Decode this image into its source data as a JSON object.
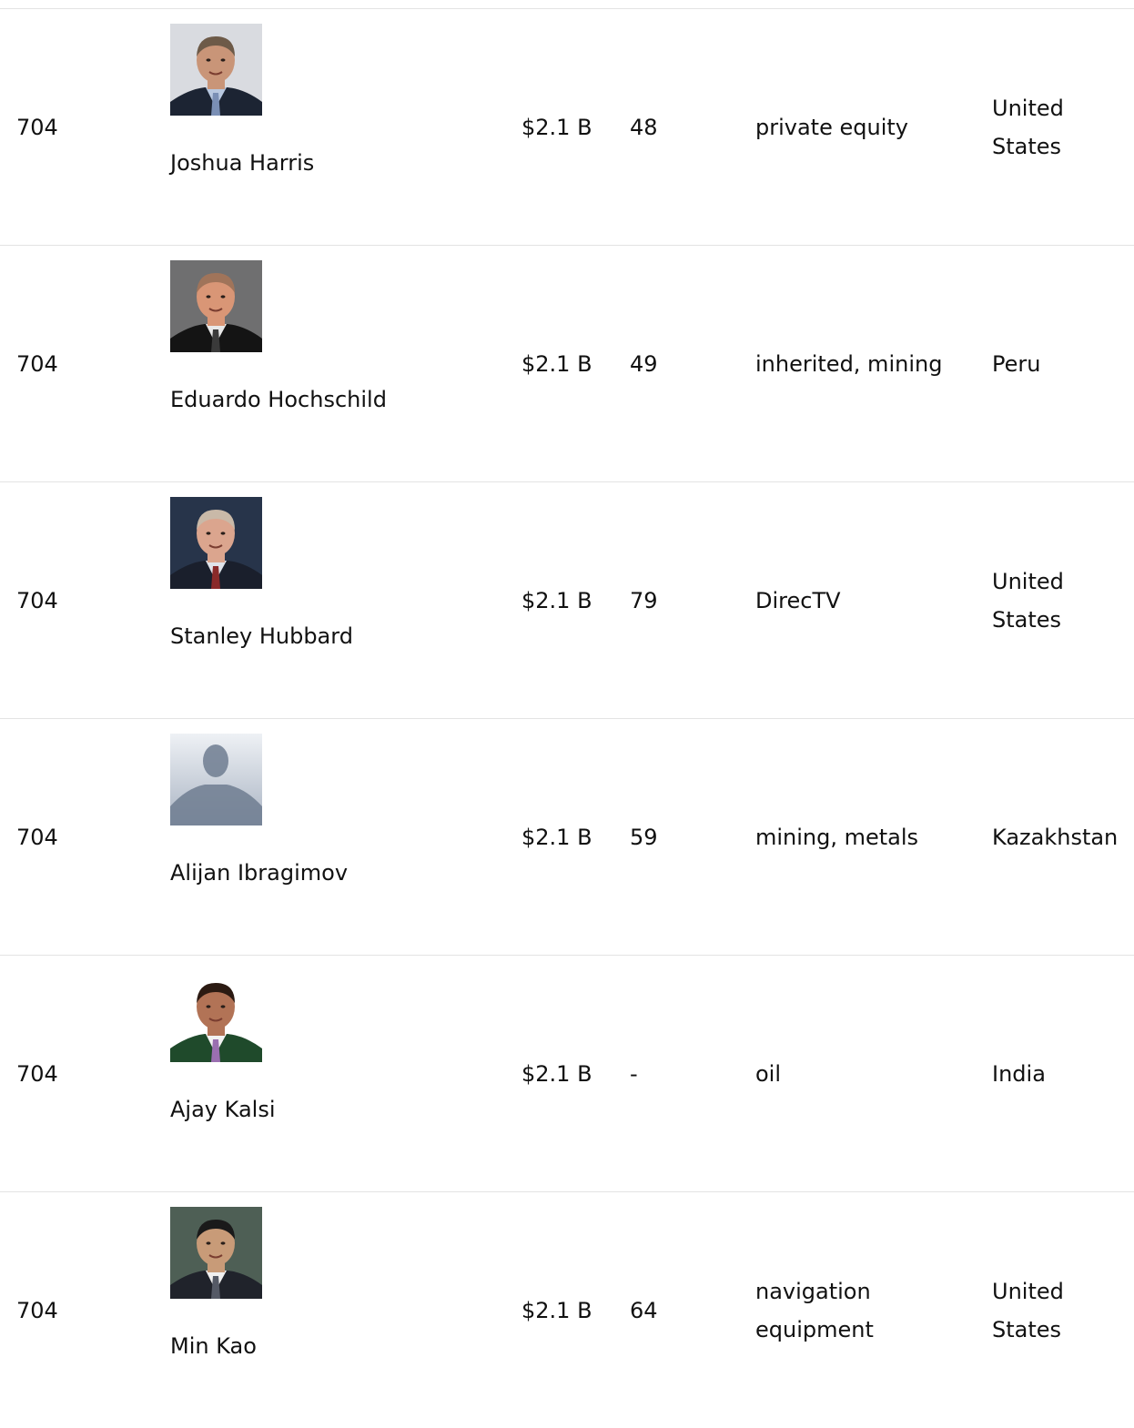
{
  "rows": [
    {
      "rank": "704",
      "name": "Joshua Harris",
      "net_worth": "$2.1 B",
      "age": "48",
      "source": "private equity",
      "country": "United States",
      "photo_icon": "person-photo-icon",
      "photo_colors": {
        "bg": "#d9dbe0",
        "skin": "#c99578",
        "hair": "#6d5a48",
        "suit": "#1c2433",
        "shirt": "#b8c8e0",
        "tie": "#7a8fb5"
      }
    },
    {
      "rank": "704",
      "name": "Eduardo Hochschild",
      "net_worth": "$2.1 B",
      "age": "49",
      "source": "inherited, mining",
      "country": "Peru",
      "photo_icon": "person-photo-icon",
      "photo_colors": {
        "bg": "#6f6f70",
        "skin": "#d99676",
        "hair": "#a0745a",
        "suit": "#141414",
        "shirt": "#e8e8e8",
        "tie": "#3a3a3a"
      }
    },
    {
      "rank": "704",
      "name": "Stanley Hubbard",
      "net_worth": "$2.1 B",
      "age": "79",
      "source": "DirecTV",
      "country": "United States",
      "photo_icon": "person-photo-icon",
      "photo_colors": {
        "bg": "#27344a",
        "skin": "#dba58e",
        "hair": "#c9b9a8",
        "suit": "#1a1f2c",
        "shirt": "#dfe3ea",
        "tie": "#8a2a2a"
      }
    },
    {
      "rank": "704",
      "name": "Alijan Ibragimov",
      "net_worth": "$2.1 B",
      "age": "59",
      "source": "mining, metals",
      "country": "Kazakhstan",
      "photo_icon": "silhouette-placeholder-icon",
      "photo_colors": {
        "bg_top": "#eef1f5",
        "bg_bottom": "#aab4c3",
        "figure": "#6f7c90"
      }
    },
    {
      "rank": "704",
      "name": "Ajay Kalsi",
      "net_worth": "$2.1 B",
      "age": "-",
      "source": "oil",
      "country": "India",
      "photo_icon": "person-photo-icon",
      "photo_colors": {
        "bg": "#ffffff",
        "skin": "#b27356",
        "hair": "#2b1a12",
        "suit": "#1f4a2b",
        "shirt": "#f2f2f2",
        "tie": "#9a6fb0"
      }
    },
    {
      "rank": "704",
      "name": "Min Kao",
      "net_worth": "$2.1 B",
      "age": "64",
      "source": "navigation equipment",
      "country": "United States",
      "photo_icon": "person-photo-icon",
      "photo_colors": {
        "bg": "#4e5f55",
        "skin": "#c89b78",
        "hair": "#1a1a1a",
        "suit": "#20232b",
        "shirt": "#f0f0f0",
        "tie": "#555a66"
      }
    }
  ]
}
